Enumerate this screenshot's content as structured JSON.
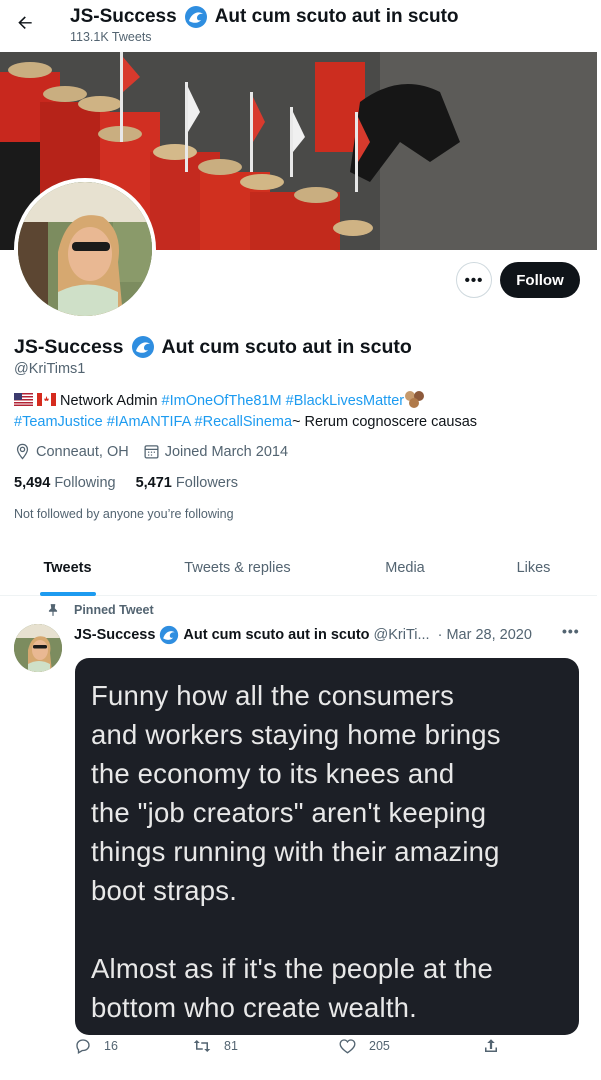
{
  "header": {
    "name": "JS-Success",
    "name_suffix": "Aut cum scuto aut in scuto",
    "tweet_count": "113.1K Tweets"
  },
  "profile": {
    "name": "JS-Success",
    "name_suffix": "Aut cum scuto aut in scuto",
    "handle": "@KriTims1",
    "follow_label": "Follow",
    "more_label": "•••",
    "bio": {
      "text1": "Network Admin ",
      "tag1": "#ImOneOfThe81M",
      "tag2": "#BlackLivesMatter",
      "tag3": "#TeamJustice",
      "tag4": "#IAmANTIFA",
      "tag5": "#RecallSinema",
      "text2": "~ Rerum cognoscere causas"
    },
    "location": "Conneaut, OH",
    "joined": "Joined March 2014",
    "following_count": "5,494",
    "following_label": "Following",
    "followers_count": "5,471",
    "followers_label": "Followers",
    "not_followed": "Not followed by anyone you’re following"
  },
  "tabs": [
    {
      "label": "Tweets",
      "active": true
    },
    {
      "label": "Tweets & replies",
      "active": false
    },
    {
      "label": "Media",
      "active": false
    },
    {
      "label": "Likes",
      "active": false
    }
  ],
  "tweet": {
    "pinned_label": "Pinned Tweet",
    "name": "JS-Success",
    "name_suffix": "Aut cum scuto aut in scuto",
    "handle": "@KriTi...",
    "date": "· Mar 28, 2020",
    "more_label": "•••",
    "image_text_1": "Funny how all the consumers\nand workers staying home brings\nthe economy to its knees and\nthe \"job creators\" aren't keeping\nthings running with their amazing\nboot straps.",
    "image_text_2": "Almost as if it's the people at the\nbottom who create wealth.",
    "replies": "16",
    "retweets": "81",
    "likes": "205"
  },
  "colors": {
    "accent": "#1d9bf0",
    "text": "#0f1419",
    "muted": "#536471",
    "rcmp_red": "#c8281e"
  },
  "icons": [
    "back-arrow-icon",
    "wave-icon",
    "location-icon",
    "calendar-icon",
    "pin-icon",
    "reply-icon",
    "retweet-icon",
    "like-icon",
    "share-icon",
    "us-flag-icon",
    "canada-flag-icon",
    "cookie-emoji-icon"
  ]
}
